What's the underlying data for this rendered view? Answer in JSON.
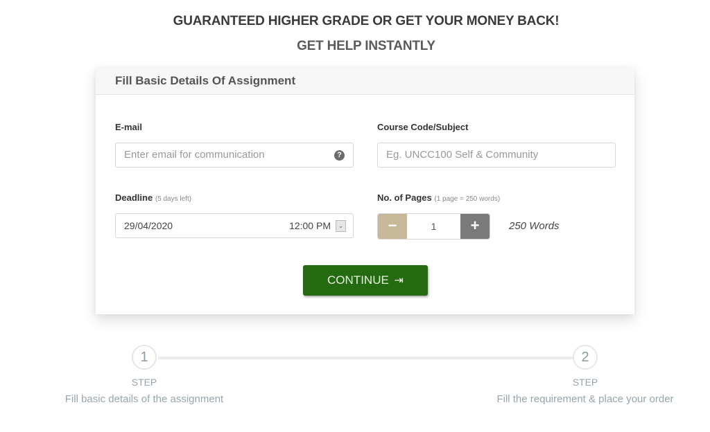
{
  "header": {
    "headline": "GUARANTEED HIGHER GRADE OR GET YOUR MONEY BACK!",
    "subheadline": "GET HELP INSTANTLY"
  },
  "form": {
    "title": "Fill Basic Details Of Assignment",
    "email": {
      "label": "E-mail",
      "placeholder": "Enter email for communication",
      "value": "",
      "help_icon": "question-circle-icon",
      "help_glyph": "?"
    },
    "course": {
      "label": "Course Code/Subject",
      "placeholder": "Eg. UNCC100 Self & Community",
      "value": ""
    },
    "deadline": {
      "label": "Deadline",
      "hint": "(5 days left)",
      "date": "29/04/2020",
      "time": "12:00 PM",
      "dropdown_glyph": "⌄"
    },
    "pages": {
      "label": "No. of Pages",
      "hint": "(1 page = 250 words)",
      "value": "1",
      "minus_glyph": "−",
      "plus_glyph": "+",
      "words": "250 Words"
    },
    "continue_label": "CONTINUE",
    "continue_icon_glyph": "⇥"
  },
  "steps": [
    {
      "number": "1",
      "word": "STEP",
      "description": "Fill basic details of the assignment"
    },
    {
      "number": "2",
      "word": "STEP",
      "description": "Fill the requirement & place your order"
    }
  ],
  "colors": {
    "continue_bg": "#236a10",
    "minus_bg": "#c8b89a",
    "plus_bg": "#7a7a7a"
  }
}
